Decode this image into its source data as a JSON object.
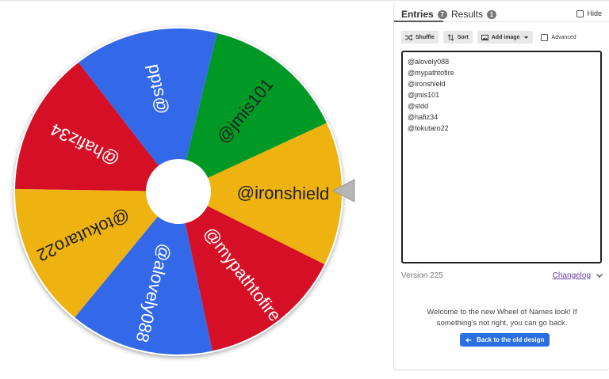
{
  "wheel": {
    "entries": [
      "@alovely088",
      "@mypathtofire",
      "@ironshield",
      "@jmis101",
      "@stdd",
      "@hafiz34",
      "@tokutaro22"
    ],
    "segments": [
      {
        "label": "@stdd",
        "color": "#3369e8",
        "text_color": "#ffffff"
      },
      {
        "label": "@jmis101",
        "color": "#009925",
        "text_color": "#222222"
      },
      {
        "label": "@ironshield",
        "color": "#eeb211",
        "text_color": "#222222"
      },
      {
        "label": "@mypathtofire",
        "color": "#d50f25",
        "text_color": "#ffffff"
      },
      {
        "label": "@alovely088",
        "color": "#3369e8",
        "text_color": "#ffffff"
      },
      {
        "label": "@tokutaro22",
        "color": "#eeb211",
        "text_color": "#222222"
      },
      {
        "label": "@hafiz34",
        "color": "#d50f25",
        "text_color": "#ffffff"
      }
    ],
    "rotation_deg": -12,
    "pointer_icon": "triangle-pointer-icon"
  },
  "tabs": {
    "entries_label": "Entries",
    "entries_count": "7",
    "results_label": "Results",
    "results_count": "1",
    "hide_label": "Hide"
  },
  "toolbar": {
    "shuffle_label": "Shuffle",
    "sort_label": "Sort",
    "add_image_label": "Add image",
    "advanced_label": "Advanced"
  },
  "entries_list": [
    "@alovely088",
    "@mypathtofire",
    "@ironshield",
    "@jmis101",
    "@stdd",
    "@hafiz34",
    "@tokutaro22"
  ],
  "footer": {
    "version": "Version 225",
    "changelog": "Changelog",
    "welcome": "Welcome to the new Wheel of Names look! If something's not right, you can go back.",
    "back_button": "Back to the old design"
  },
  "colors": {
    "blue": "#3369e8",
    "green": "#009925",
    "yellow": "#eeb211",
    "red": "#d50f25",
    "accent": "#2a6fe3",
    "link": "#6a3fa0"
  }
}
